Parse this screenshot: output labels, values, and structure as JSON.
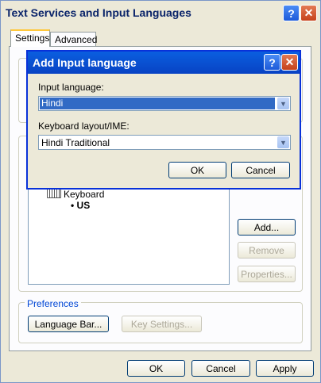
{
  "window": {
    "title": "Text Services and Input Languages"
  },
  "tabs": {
    "settings": "Settings",
    "advanced": "Advanced"
  },
  "services": {
    "keyboard_label": "Keyboard",
    "layout_label": "US"
  },
  "side_buttons": {
    "add": "Add...",
    "remove": "Remove",
    "properties": "Properties..."
  },
  "preferences": {
    "label": "Preferences",
    "language_bar": "Language Bar...",
    "key_settings": "Key Settings..."
  },
  "footer": {
    "ok": "OK",
    "cancel": "Cancel",
    "apply": "Apply"
  },
  "dialog": {
    "title": "Add Input language",
    "input_language_label": "Input language:",
    "input_language_value": "Hindi",
    "keyboard_layout_label": "Keyboard layout/IME:",
    "keyboard_layout_value": "Hindi Traditional",
    "ok": "OK",
    "cancel": "Cancel"
  },
  "icons": {
    "help": "?",
    "close": "✕",
    "dropdown": "▼"
  }
}
